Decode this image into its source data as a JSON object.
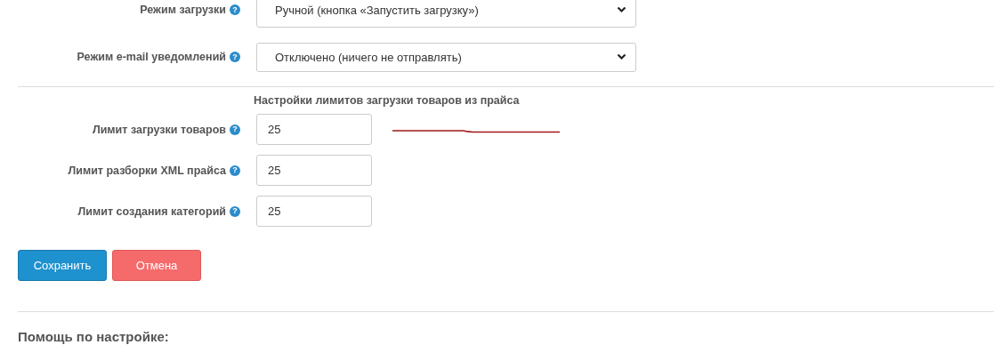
{
  "selects": [
    {
      "label": "Режим загрузки",
      "hint_icon": "?",
      "value": "Ручной (кнопка «Запустить загрузку»)"
    },
    {
      "label": "Режим e-mail уведомлений",
      "hint_icon": "?",
      "value": "Отключено (ничего не отправлять)"
    }
  ],
  "limits_section": {
    "title": "Настройки лимитов загрузки товаров из прайса",
    "fields": [
      {
        "label": "Лимит загрузки товаров",
        "hint_icon": "?",
        "value": "25",
        "annotated": true
      },
      {
        "label": "Лимит разборки XML прайса",
        "hint_icon": "?",
        "value": "25",
        "annotated": false
      },
      {
        "label": "Лимит создания категорий",
        "hint_icon": "?",
        "value": "25",
        "annotated": false
      }
    ]
  },
  "buttons": [
    {
      "label": "Сохранить",
      "kind": "primary"
    },
    {
      "label": "Отмена",
      "kind": "danger"
    }
  ],
  "help": {
    "title": "Помощь по настройке:"
  }
}
